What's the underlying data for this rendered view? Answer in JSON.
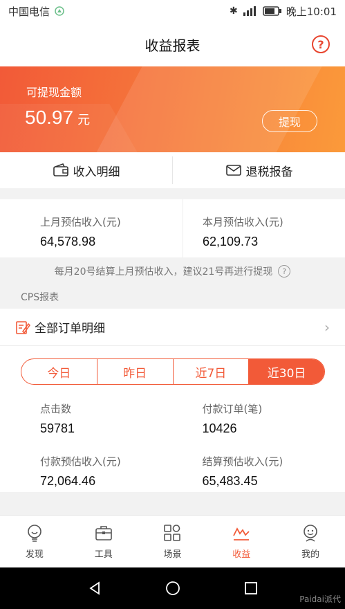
{
  "status_bar": {
    "carrier": "中国电信",
    "time": "晚上10:01"
  },
  "header": {
    "title": "收益报表",
    "help": "?"
  },
  "banner": {
    "label": "可提现金额",
    "amount": "50.97",
    "unit": "元",
    "withdraw_label": "提现"
  },
  "actions": [
    {
      "label": "收入明细",
      "icon": "wallet-icon"
    },
    {
      "label": "退税报备",
      "icon": "envelope-icon"
    }
  ],
  "stats": [
    {
      "label": "上月预估收入(元)",
      "value": "64,578.98"
    },
    {
      "label": "本月预估收入(元)",
      "value": "62,109.73"
    }
  ],
  "note": "每月20号结算上月预估收入，建议21号再进行提现",
  "cps": {
    "section_title": "CPS报表",
    "orders_label": "全部订单明细"
  },
  "tabs": [
    {
      "label": "今日",
      "active": false
    },
    {
      "label": "昨日",
      "active": false
    },
    {
      "label": "近7日",
      "active": false
    },
    {
      "label": "近30日",
      "active": true
    }
  ],
  "metrics": [
    {
      "label": "点击数",
      "value": "59781"
    },
    {
      "label": "付款订单(笔)",
      "value": "10426"
    },
    {
      "label": "付款预估收入(元)",
      "value": "72,064.46"
    },
    {
      "label": "结算预估收入(元)",
      "value": "65,483.45"
    }
  ],
  "tabbar": [
    {
      "label": "发现",
      "icon": "bulb-icon",
      "active": false
    },
    {
      "label": "工具",
      "icon": "toolbox-icon",
      "active": false
    },
    {
      "label": "场景",
      "icon": "grid-icon",
      "active": false
    },
    {
      "label": "收益",
      "icon": "chart-icon",
      "active": true
    },
    {
      "label": "我的",
      "icon": "user-icon",
      "active": false
    }
  ],
  "watermark": "Paidai派代",
  "colors": {
    "accent": "#f25a38",
    "banner_end": "#fb9a3a"
  }
}
